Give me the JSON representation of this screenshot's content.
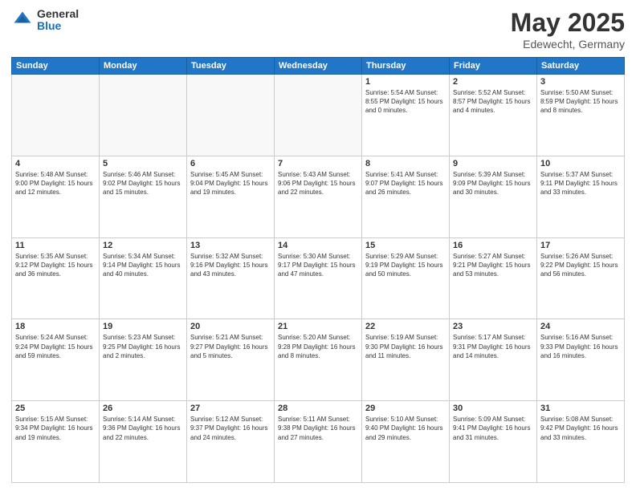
{
  "header": {
    "logo_general": "General",
    "logo_blue": "Blue",
    "month_title": "May 2025",
    "location": "Edewecht, Germany"
  },
  "days_of_week": [
    "Sunday",
    "Monday",
    "Tuesday",
    "Wednesday",
    "Thursday",
    "Friday",
    "Saturday"
  ],
  "weeks": [
    [
      {
        "day": "",
        "info": ""
      },
      {
        "day": "",
        "info": ""
      },
      {
        "day": "",
        "info": ""
      },
      {
        "day": "",
        "info": ""
      },
      {
        "day": "1",
        "info": "Sunrise: 5:54 AM\nSunset: 8:55 PM\nDaylight: 15 hours\nand 0 minutes."
      },
      {
        "day": "2",
        "info": "Sunrise: 5:52 AM\nSunset: 8:57 PM\nDaylight: 15 hours\nand 4 minutes."
      },
      {
        "day": "3",
        "info": "Sunrise: 5:50 AM\nSunset: 8:59 PM\nDaylight: 15 hours\nand 8 minutes."
      }
    ],
    [
      {
        "day": "4",
        "info": "Sunrise: 5:48 AM\nSunset: 9:00 PM\nDaylight: 15 hours\nand 12 minutes."
      },
      {
        "day": "5",
        "info": "Sunrise: 5:46 AM\nSunset: 9:02 PM\nDaylight: 15 hours\nand 15 minutes."
      },
      {
        "day": "6",
        "info": "Sunrise: 5:45 AM\nSunset: 9:04 PM\nDaylight: 15 hours\nand 19 minutes."
      },
      {
        "day": "7",
        "info": "Sunrise: 5:43 AM\nSunset: 9:06 PM\nDaylight: 15 hours\nand 22 minutes."
      },
      {
        "day": "8",
        "info": "Sunrise: 5:41 AM\nSunset: 9:07 PM\nDaylight: 15 hours\nand 26 minutes."
      },
      {
        "day": "9",
        "info": "Sunrise: 5:39 AM\nSunset: 9:09 PM\nDaylight: 15 hours\nand 30 minutes."
      },
      {
        "day": "10",
        "info": "Sunrise: 5:37 AM\nSunset: 9:11 PM\nDaylight: 15 hours\nand 33 minutes."
      }
    ],
    [
      {
        "day": "11",
        "info": "Sunrise: 5:35 AM\nSunset: 9:12 PM\nDaylight: 15 hours\nand 36 minutes."
      },
      {
        "day": "12",
        "info": "Sunrise: 5:34 AM\nSunset: 9:14 PM\nDaylight: 15 hours\nand 40 minutes."
      },
      {
        "day": "13",
        "info": "Sunrise: 5:32 AM\nSunset: 9:16 PM\nDaylight: 15 hours\nand 43 minutes."
      },
      {
        "day": "14",
        "info": "Sunrise: 5:30 AM\nSunset: 9:17 PM\nDaylight: 15 hours\nand 47 minutes."
      },
      {
        "day": "15",
        "info": "Sunrise: 5:29 AM\nSunset: 9:19 PM\nDaylight: 15 hours\nand 50 minutes."
      },
      {
        "day": "16",
        "info": "Sunrise: 5:27 AM\nSunset: 9:21 PM\nDaylight: 15 hours\nand 53 minutes."
      },
      {
        "day": "17",
        "info": "Sunrise: 5:26 AM\nSunset: 9:22 PM\nDaylight: 15 hours\nand 56 minutes."
      }
    ],
    [
      {
        "day": "18",
        "info": "Sunrise: 5:24 AM\nSunset: 9:24 PM\nDaylight: 15 hours\nand 59 minutes."
      },
      {
        "day": "19",
        "info": "Sunrise: 5:23 AM\nSunset: 9:25 PM\nDaylight: 16 hours\nand 2 minutes."
      },
      {
        "day": "20",
        "info": "Sunrise: 5:21 AM\nSunset: 9:27 PM\nDaylight: 16 hours\nand 5 minutes."
      },
      {
        "day": "21",
        "info": "Sunrise: 5:20 AM\nSunset: 9:28 PM\nDaylight: 16 hours\nand 8 minutes."
      },
      {
        "day": "22",
        "info": "Sunrise: 5:19 AM\nSunset: 9:30 PM\nDaylight: 16 hours\nand 11 minutes."
      },
      {
        "day": "23",
        "info": "Sunrise: 5:17 AM\nSunset: 9:31 PM\nDaylight: 16 hours\nand 14 minutes."
      },
      {
        "day": "24",
        "info": "Sunrise: 5:16 AM\nSunset: 9:33 PM\nDaylight: 16 hours\nand 16 minutes."
      }
    ],
    [
      {
        "day": "25",
        "info": "Sunrise: 5:15 AM\nSunset: 9:34 PM\nDaylight: 16 hours\nand 19 minutes."
      },
      {
        "day": "26",
        "info": "Sunrise: 5:14 AM\nSunset: 9:36 PM\nDaylight: 16 hours\nand 22 minutes."
      },
      {
        "day": "27",
        "info": "Sunrise: 5:12 AM\nSunset: 9:37 PM\nDaylight: 16 hours\nand 24 minutes."
      },
      {
        "day": "28",
        "info": "Sunrise: 5:11 AM\nSunset: 9:38 PM\nDaylight: 16 hours\nand 27 minutes."
      },
      {
        "day": "29",
        "info": "Sunrise: 5:10 AM\nSunset: 9:40 PM\nDaylight: 16 hours\nand 29 minutes."
      },
      {
        "day": "30",
        "info": "Sunrise: 5:09 AM\nSunset: 9:41 PM\nDaylight: 16 hours\nand 31 minutes."
      },
      {
        "day": "31",
        "info": "Sunrise: 5:08 AM\nSunset: 9:42 PM\nDaylight: 16 hours\nand 33 minutes."
      }
    ]
  ]
}
